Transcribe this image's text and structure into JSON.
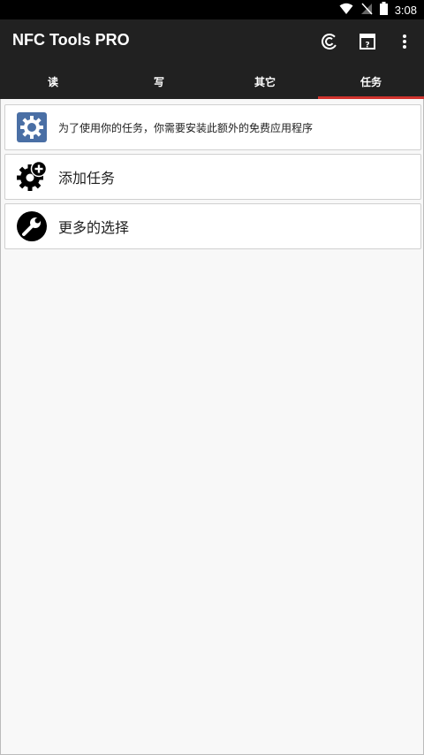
{
  "status_bar": {
    "time": "3:08",
    "icons": [
      "wifi-icon",
      "no-signal-icon",
      "battery-icon"
    ]
  },
  "app_bar": {
    "title": "NFC Tools PRO",
    "actions": [
      "nfc-icon",
      "help-icon",
      "overflow-menu-icon"
    ]
  },
  "tabs": [
    {
      "label": "读",
      "active": false
    },
    {
      "label": "写",
      "active": false
    },
    {
      "label": "其它",
      "active": false
    },
    {
      "label": "任务",
      "active": true
    }
  ],
  "accent_color": "#d0332e",
  "list": [
    {
      "label": "为了使用你的任务，你需要安装此额外的免费应用程序",
      "icon": "app-gear-icon"
    },
    {
      "label": "添加任务",
      "icon": "gear-add-icon"
    },
    {
      "label": "更多的选择",
      "icon": "wrench-icon"
    }
  ]
}
